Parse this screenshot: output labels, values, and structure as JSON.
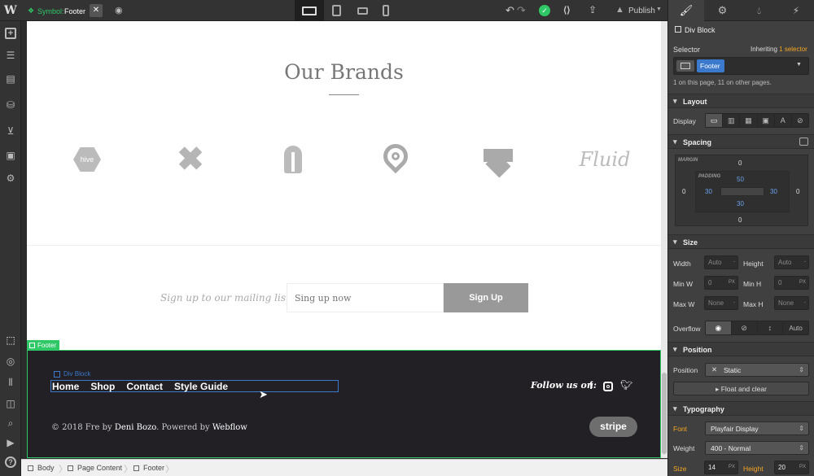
{
  "topbar": {
    "symbol_prefix": "Symbol:",
    "symbol_name": "Footer",
    "publish_label": "Publish"
  },
  "canvas": {
    "brands_title": "Our Brands",
    "mailing_text": "Sign up to our mailing list",
    "signup_placeholder": "Sing up now",
    "signup_button": "Sign Up",
    "footer_tag": "Footer",
    "divblock_tag": "Div Block",
    "nav": [
      "Home",
      "Shop",
      "Contact",
      "Style Guide"
    ],
    "follow_text": "Follow us on:",
    "copyright_pre": "© 2018 Fre by",
    "copyright_author": "Deni Bozo",
    "copyright_mid": ". Powered by",
    "copyright_platform": "Webflow",
    "stripe_label": "stripe",
    "brand_hive": "hive",
    "brand_fluid": "Fluid"
  },
  "breadcrumbs": [
    "Body",
    "Page Content",
    "Footer"
  ],
  "panel": {
    "element_type": "Div Block",
    "selector_label": "Selector",
    "inheriting": "Inheriting",
    "inheriting_count": "1 selector",
    "selector_chip": "Footer",
    "usage_note": "1 on this page, 11 on other pages.",
    "layout": "Layout",
    "display": "Display",
    "spacing": "Spacing",
    "margin": "MARGIN",
    "padding": "PADDING",
    "margin_vals": {
      "top": "0",
      "right": "0",
      "bottom": "0",
      "left": "0"
    },
    "padding_vals": {
      "top": "50",
      "right": "30",
      "bottom": "30",
      "left": "30"
    },
    "size": "Size",
    "width": "Width",
    "height": "Height",
    "min_w": "Min W",
    "min_h": "Min H",
    "max_w": "Max W",
    "max_h": "Max H",
    "auto": "Auto",
    "zero": "0",
    "none": "None",
    "px": "PX",
    "dash": "-",
    "overflow": "Overflow",
    "overflow_auto": "Auto",
    "position_section": "Position",
    "position_label": "Position",
    "position_value": "Static",
    "float_clear": "Float and clear",
    "typography": "Typography",
    "font": "Font",
    "font_value": "Playfair Display",
    "weight": "Weight",
    "weight_value": "400 - Normal",
    "size_label": "Size",
    "size_value": "14",
    "line_height": "Height",
    "line_height_value": "20"
  },
  "colors": {
    "accent": "#3b79cc",
    "green": "#2ec866",
    "orange": "#f5a623",
    "footer_bg": "#222025"
  }
}
